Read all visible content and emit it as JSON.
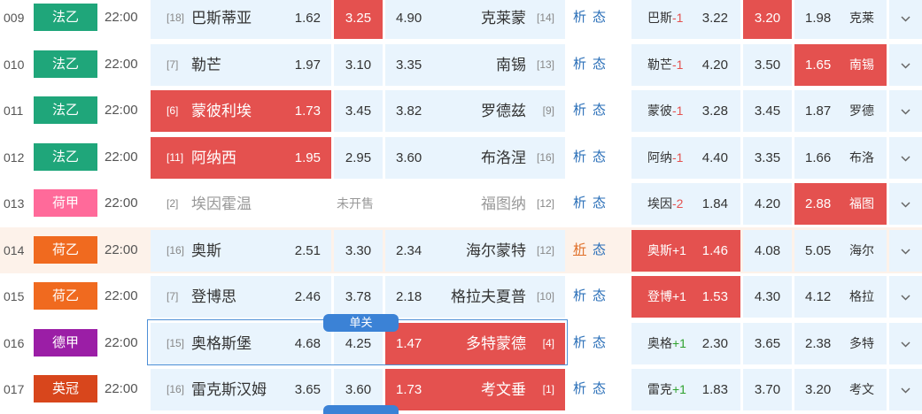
{
  "colors": {
    "accent_blue": "#3b82d6",
    "cell_bg": "#e9f4fd",
    "highlight_red": "#e4514f",
    "handicap_pos": "#2ea12e"
  },
  "selected_tag": "单关",
  "matches": [
    {
      "num": "009",
      "league": "法乙",
      "league_color": "#1fa67a",
      "time": "22:00",
      "home_rank": "[18]",
      "home": "巴斯蒂亚",
      "h": "1.62",
      "d": "3.25",
      "a": "4.90",
      "away": "克莱蒙",
      "away_rank": "[14]",
      "sel": "d",
      "xi": "析",
      "tai": "态",
      "hc_name": "巴斯",
      "hc_val": "-1",
      "hc_h": "3.22",
      "hc_d": "3.20",
      "hc_a": "1.98",
      "hc_away": "克莱",
      "hc_sel": "d"
    },
    {
      "num": "010",
      "league": "法乙",
      "league_color": "#1fa67a",
      "time": "22:00",
      "home_rank": "[7]",
      "home": "勒芒",
      "h": "1.97",
      "d": "3.10",
      "a": "3.35",
      "away": "南锡",
      "away_rank": "[13]",
      "sel": "",
      "xi": "析",
      "tai": "态",
      "hc_name": "勒芒",
      "hc_val": "-1",
      "hc_h": "4.20",
      "hc_d": "3.50",
      "hc_a": "1.65",
      "hc_away": "南锡",
      "hc_sel": "a"
    },
    {
      "num": "011",
      "league": "法乙",
      "league_color": "#1fa67a",
      "time": "22:00",
      "home_rank": "[6]",
      "home": "蒙彼利埃",
      "h": "1.73",
      "d": "3.45",
      "a": "3.82",
      "away": "罗德兹",
      "away_rank": "[9]",
      "sel": "h",
      "xi": "析",
      "tai": "态",
      "hc_name": "蒙彼",
      "hc_val": "-1",
      "hc_h": "3.28",
      "hc_d": "3.45",
      "hc_a": "1.87",
      "hc_away": "罗德",
      "hc_sel": ""
    },
    {
      "num": "012",
      "league": "法乙",
      "league_color": "#1fa67a",
      "time": "22:00",
      "home_rank": "[11]",
      "home": "阿纳西",
      "h": "1.95",
      "d": "2.95",
      "a": "3.60",
      "away": "布洛涅",
      "away_rank": "[16]",
      "sel": "h",
      "xi": "析",
      "tai": "态",
      "hc_name": "阿纳",
      "hc_val": "-1",
      "hc_h": "4.40",
      "hc_d": "3.35",
      "hc_a": "1.66",
      "hc_away": "布洛",
      "hc_sel": ""
    },
    {
      "num": "013",
      "league": "荷甲",
      "league_color": "#ff6a9a",
      "time": "22:00",
      "home_rank": "[2]",
      "home": "埃因霍温",
      "status": "未开售",
      "away": "福图纳",
      "away_rank": "[12]",
      "sel": "",
      "closed": true,
      "xi": "析",
      "tai": "态",
      "hc_name": "埃因",
      "hc_val": "-2",
      "hc_h": "1.84",
      "hc_d": "4.20",
      "hc_a": "2.88",
      "hc_away": "福图",
      "hc_sel": "a"
    },
    {
      "num": "014",
      "league": "荷乙",
      "league_color": "#f06a1f",
      "time": "22:00",
      "home_rank": "[16]",
      "home": "奥斯",
      "h": "2.51",
      "d": "3.30",
      "a": "2.34",
      "away": "海尔蒙特",
      "away_rank": "[12]",
      "sel": "",
      "xi": "析",
      "tai": "态",
      "hc_name": "奥斯",
      "hc_val": "+1",
      "hc_h": "1.46",
      "hc_d": "4.08",
      "hc_a": "5.05",
      "hc_away": "海尔",
      "hc_sel": "h",
      "row_hl": true
    },
    {
      "num": "015",
      "league": "荷乙",
      "league_color": "#f06a1f",
      "time": "22:00",
      "home_rank": "[7]",
      "home": "登博思",
      "h": "2.46",
      "d": "3.78",
      "a": "2.18",
      "away": "格拉夫夏普",
      "away_rank": "[10]",
      "sel": "",
      "xi": "析",
      "tai": "态",
      "hc_name": "登博",
      "hc_val": "+1",
      "hc_h": "1.53",
      "hc_d": "4.30",
      "hc_a": "4.12",
      "hc_away": "格拉",
      "hc_sel": "h"
    },
    {
      "num": "016",
      "league": "德甲",
      "league_color": "#9b1ea6",
      "time": "22:00",
      "home_rank": "[15]",
      "home": "奥格斯堡",
      "h": "4.68",
      "d": "4.25",
      "a": "1.47",
      "away": "多特蒙德",
      "away_rank": "[4]",
      "sel": "a",
      "xi": "析",
      "tai": "态",
      "hc_name": "奥格",
      "hc_val": "+1",
      "hc_h": "2.30",
      "hc_d": "3.65",
      "hc_a": "2.38",
      "hc_away": "多特",
      "hc_sel": ""
    },
    {
      "num": "017",
      "league": "英冠",
      "league_color": "#d8461c",
      "time": "22:00",
      "home_rank": "[16]",
      "home": "雷克斯汉姆",
      "h": "3.65",
      "d": "3.60",
      "a": "1.73",
      "away": "考文垂",
      "away_rank": "[1]",
      "sel": "a",
      "xi": "析",
      "tai": "态",
      "hc_name": "雷克",
      "hc_val": "+1",
      "hc_h": "1.83",
      "hc_d": "3.70",
      "hc_a": "3.20",
      "hc_away": "考文",
      "hc_sel": ""
    }
  ]
}
